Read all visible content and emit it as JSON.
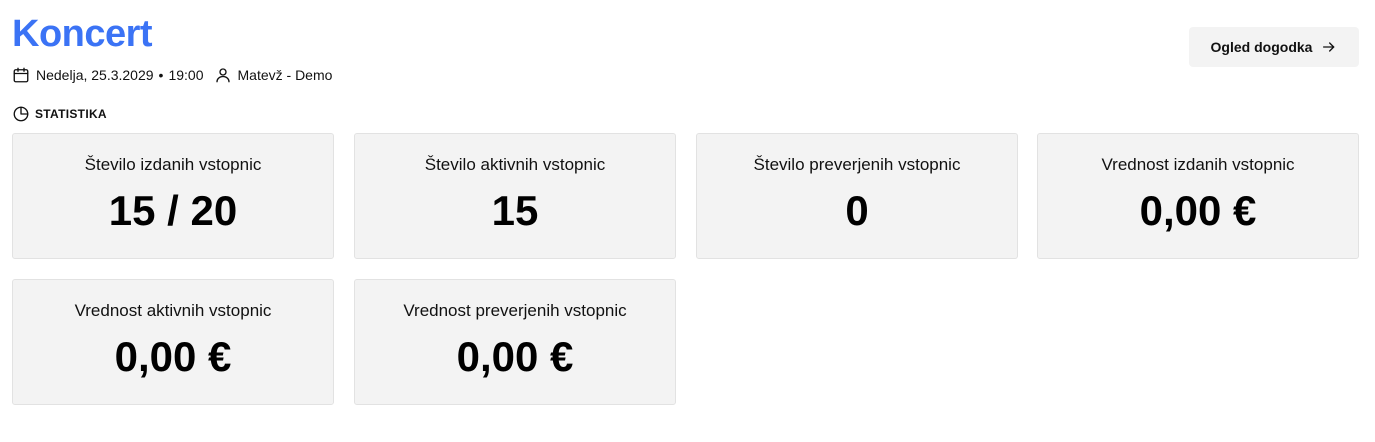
{
  "event": {
    "title": "Koncert",
    "date_time": "Nedelja, 25.3.2029",
    "separator": "•",
    "time": "19:00",
    "organizer": "Matevž - Demo",
    "accent_color": "#3b73f5"
  },
  "actions": {
    "view_event_label": "Ogled dogodka"
  },
  "stats_section": {
    "label": "STATISTIKA",
    "cards": [
      {
        "label": "Število izdanih vstopnic",
        "value": "15 / 20"
      },
      {
        "label": "Število aktivnih vstopnic",
        "value": "15"
      },
      {
        "label": "Število preverjenih vstopnic",
        "value": "0"
      },
      {
        "label": "Vrednost izdanih vstopnic",
        "value": "0,00 €"
      },
      {
        "label": "Vrednost aktivnih vstopnic",
        "value": "0,00 €"
      },
      {
        "label": "Vrednost preverjenih vstopnic",
        "value": "0,00 €"
      }
    ]
  },
  "icons": {
    "calendar": "calendar-icon",
    "user": "user-icon",
    "arrow": "arrow-right-icon",
    "chart": "pie-chart-icon"
  }
}
